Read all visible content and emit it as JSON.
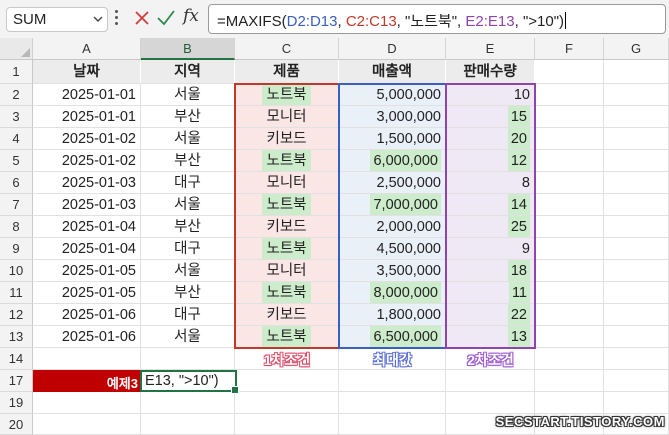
{
  "name_box": "SUM",
  "formula": {
    "parts": [
      {
        "text": "=MAXIFS(",
        "color": "#222222"
      },
      {
        "text": "D2:D13",
        "color": "#3b5fc0"
      },
      {
        "text": ", ",
        "color": "#222222"
      },
      {
        "text": "C2:C13",
        "color": "#c0392b"
      },
      {
        "text": ", \"노트북\", ",
        "color": "#222222"
      },
      {
        "text": "E2:E13",
        "color": "#8e44ad"
      },
      {
        "text": ", \">10\")",
        "color": "#222222"
      }
    ]
  },
  "columns": [
    "A",
    "B",
    "C",
    "D",
    "E",
    "F",
    "G"
  ],
  "selected_column": "B",
  "row_numbers": [
    "1",
    "2",
    "3",
    "4",
    "5",
    "6",
    "7",
    "8",
    "9",
    "10",
    "11",
    "12",
    "13",
    "14",
    "17",
    "19",
    "20"
  ],
  "headers": {
    "A": "날짜",
    "B": "지역",
    "C": "제품",
    "D": "매출액",
    "E": "판매수량"
  },
  "rows": [
    {
      "date": "2025-01-01",
      "region": "서울",
      "product": "노트북",
      "sales": "5,000,000",
      "qty": "10",
      "prod_match": true,
      "qty_match": false
    },
    {
      "date": "2025-01-01",
      "region": "부산",
      "product": "모니터",
      "sales": "3,000,000",
      "qty": "15",
      "prod_match": false,
      "qty_match": true
    },
    {
      "date": "2025-01-02",
      "region": "서울",
      "product": "키보드",
      "sales": "1,500,000",
      "qty": "20",
      "prod_match": false,
      "qty_match": true
    },
    {
      "date": "2025-01-02",
      "region": "부산",
      "product": "노트북",
      "sales": "6,000,000",
      "qty": "12",
      "prod_match": true,
      "qty_match": true
    },
    {
      "date": "2025-01-03",
      "region": "대구",
      "product": "모니터",
      "sales": "2,500,000",
      "qty": "8",
      "prod_match": false,
      "qty_match": false
    },
    {
      "date": "2025-01-03",
      "region": "서울",
      "product": "노트북",
      "sales": "7,000,000",
      "qty": "14",
      "prod_match": true,
      "qty_match": true
    },
    {
      "date": "2025-01-04",
      "region": "부산",
      "product": "키보드",
      "sales": "2,000,000",
      "qty": "25",
      "prod_match": false,
      "qty_match": true
    },
    {
      "date": "2025-01-04",
      "region": "대구",
      "product": "노트북",
      "sales": "4,500,000",
      "qty": "9",
      "prod_match": true,
      "qty_match": false
    },
    {
      "date": "2025-01-05",
      "region": "서울",
      "product": "모니터",
      "sales": "3,500,000",
      "qty": "18",
      "prod_match": false,
      "qty_match": true
    },
    {
      "date": "2025-01-05",
      "region": "부산",
      "product": "노트북",
      "sales": "8,000,000",
      "qty": "11",
      "prod_match": true,
      "qty_match": true
    },
    {
      "date": "2025-01-06",
      "region": "대구",
      "product": "키보드",
      "sales": "1,800,000",
      "qty": "22",
      "prod_match": false,
      "qty_match": true
    },
    {
      "date": "2025-01-06",
      "region": "서울",
      "product": "노트북",
      "sales": "6,500,000",
      "qty": "13",
      "prod_match": true,
      "qty_match": true
    }
  ],
  "sales_highlight_rows": [
    3,
    5,
    9,
    11
  ],
  "labels": {
    "condition1": "1차조건",
    "max_value": "최대값",
    "condition2": "2차조건",
    "condition1_color": "#d94b68",
    "max_value_color": "#5b6fd6",
    "condition2_color": "#9b59d0"
  },
  "example_label": "예제3",
  "active_cell_text": "E13, \">10\")",
  "watermark": "SECSTART.TISTORY.COM",
  "colors": {
    "accent_green": "#217346",
    "example_red": "#c00000",
    "range_c": "#c0392b",
    "range_d": "#3b5fc0",
    "range_e": "#8e44ad",
    "match_fill": "#cdeccb"
  }
}
